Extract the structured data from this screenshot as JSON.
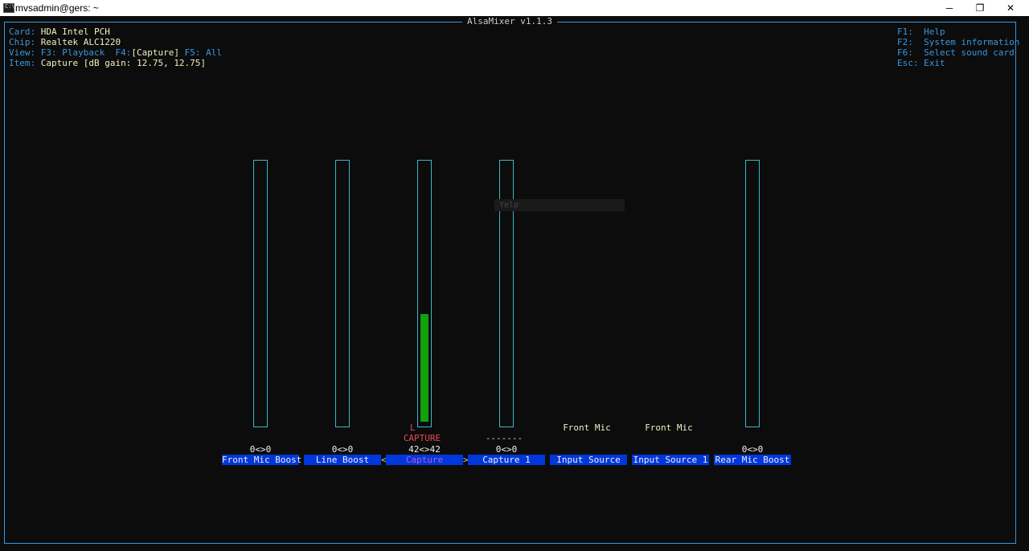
{
  "window": {
    "title": "mvsadmin@gers: ~",
    "icon_text": "C:\\",
    "min_glyph": "─",
    "max_glyph": "❐",
    "close_glyph": "✕"
  },
  "app": {
    "title": "AlsaMixer v1.1.3"
  },
  "info": {
    "card_label": "Card:",
    "card_value": "HDA Intel PCH",
    "chip_label": "Chip:",
    "chip_value": "Realtek ALC1220",
    "view_label": "View:",
    "view_f3": "F3: Playback",
    "view_f4_key": "F4:",
    "view_f4_value": "[Capture]",
    "view_f5": "F5: All",
    "item_label": "Item:",
    "item_value": "Capture [dB gain: 12.75, 12.75]"
  },
  "help": [
    "F1:  Help",
    "F2:  System information",
    "F6:  Select sound card",
    "Esc: Exit"
  ],
  "controls": [
    {
      "name": "Front Mic Boost",
      "level": "0<>0",
      "volume_pct": 0
    },
    {
      "name": "Line Boost",
      "level": "0<>0",
      "volume_pct": 0
    },
    {
      "name": "Capture",
      "level": "42<>42",
      "volume_pct": 42,
      "capture_lr": "L",
      "capture_text": "CAPTURE",
      "active": true
    },
    {
      "name": "Capture 1",
      "level": "0<>0",
      "dashes": "-------",
      "volume_pct": 0
    },
    {
      "name": "Input Source",
      "enum_value": "Front Mic"
    },
    {
      "name": "Input Source 1",
      "enum_value": "Front Mic"
    },
    {
      "name": "Rear Mic Boost",
      "level": "0<>0",
      "volume_pct": 0
    }
  ],
  "overlay_text": "    Yelp",
  "nav_left": "<",
  "nav_right": ">",
  "colors": {
    "border": "#3a96dd",
    "label_bg": "#0037da",
    "fill": "#13a10e",
    "capture": "#e74856"
  }
}
